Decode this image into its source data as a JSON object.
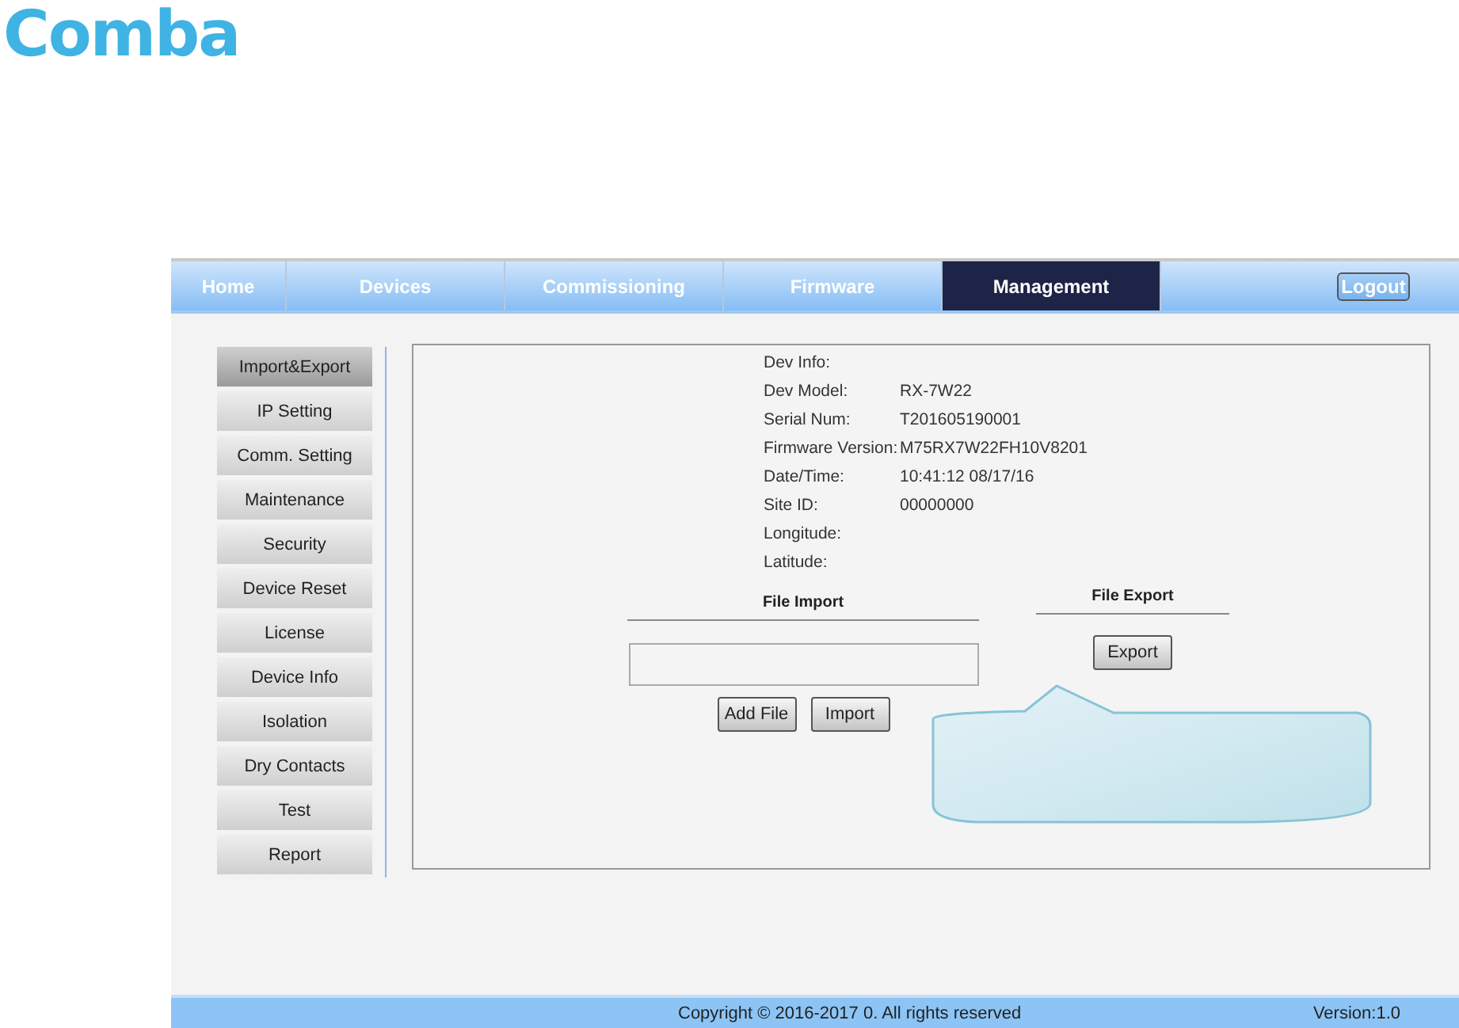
{
  "logo": {
    "text": "Comba"
  },
  "nav": {
    "tabs": [
      {
        "label": "Home",
        "selected": false
      },
      {
        "label": "Devices",
        "selected": false
      },
      {
        "label": "Commissioning",
        "selected": false
      },
      {
        "label": "Firmware",
        "selected": false
      },
      {
        "label": "Management",
        "selected": true
      }
    ],
    "logout": "Logout"
  },
  "sidebar": {
    "items": [
      {
        "label": "Import&Export",
        "selected": true
      },
      {
        "label": "IP Setting",
        "selected": false
      },
      {
        "label": "Comm. Setting",
        "selected": false
      },
      {
        "label": "Maintenance",
        "selected": false
      },
      {
        "label": "Security",
        "selected": false
      },
      {
        "label": "Device Reset",
        "selected": false
      },
      {
        "label": "License",
        "selected": false
      },
      {
        "label": "Device Info",
        "selected": false
      },
      {
        "label": "Isolation",
        "selected": false
      },
      {
        "label": "Dry Contacts",
        "selected": false
      },
      {
        "label": "Test",
        "selected": false
      },
      {
        "label": "Report",
        "selected": false
      }
    ]
  },
  "dev_info": {
    "title": "Dev Info:",
    "fields": [
      {
        "label": "Dev Model:",
        "value": "RX-7W22"
      },
      {
        "label": "Serial Num:",
        "value": "T201605190001"
      },
      {
        "label": "Firmware Version:",
        "value": "M75RX7W22FH10V8201"
      },
      {
        "label": "Date/Time:",
        "value": "10:41:12 08/17/16"
      },
      {
        "label": "Site ID:",
        "value": "00000000"
      },
      {
        "label": "Longitude:"
      },
      {
        "label": "Latitude:"
      }
    ]
  },
  "file_import": {
    "heading": "File Import",
    "buttons": [
      "Add File",
      "Import"
    ]
  },
  "file_export": {
    "heading": "File Export",
    "button": "Export"
  },
  "footer": {
    "copyright": "Copyright © 2016-2017 0. All rights reserved",
    "version": "Version:1.0"
  }
}
